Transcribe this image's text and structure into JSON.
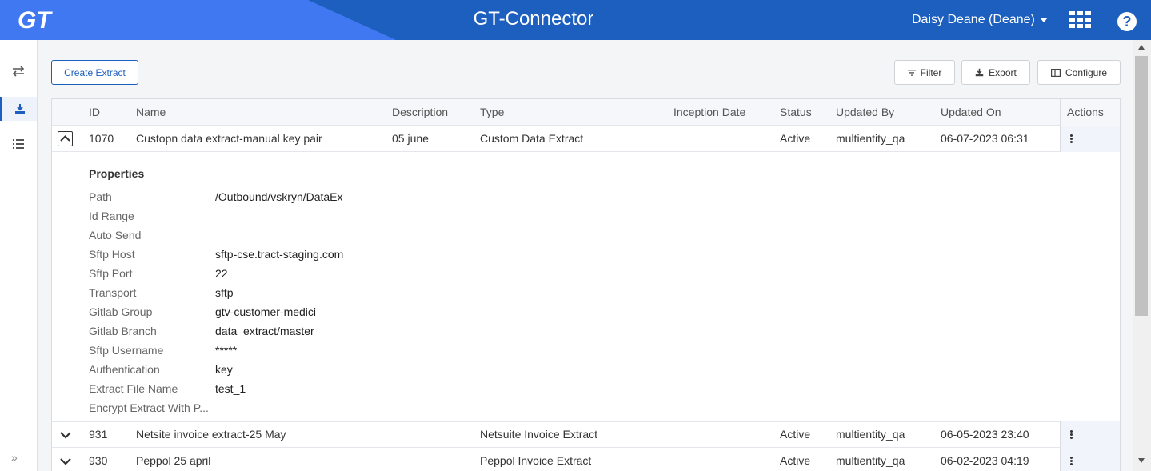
{
  "header": {
    "logo_text": "GT",
    "title": "GT-Connector",
    "user": "Daisy Deane (Deane)",
    "apps_icon": "grid-apps-icon",
    "help_icon": "help-icon",
    "help_label": "?"
  },
  "sidebar": {
    "items": [
      {
        "icon": "swap-arrows-icon"
      },
      {
        "icon": "download-icon",
        "active": true
      },
      {
        "icon": "list-icon"
      }
    ],
    "expand_label": "»"
  },
  "toolbar": {
    "create_label": "Create Extract",
    "filter_label": "Filter",
    "export_label": "Export",
    "configure_label": "Configure"
  },
  "table": {
    "columns": [
      "ID",
      "Name",
      "Description",
      "Type",
      "Inception Date",
      "Status",
      "Updated By",
      "Updated On",
      "Actions"
    ],
    "rows": [
      {
        "id": "1070",
        "name": "Custopn data extract-manual key pair",
        "description": "05 june",
        "type": "Custom Data Extract",
        "inception": "",
        "status": "Active",
        "updated_by": "multientity_qa",
        "updated_on": "06-07-2023 06:31",
        "expanded": true
      },
      {
        "id": "931",
        "name": "Netsite invoice extract-25 May",
        "description": "",
        "type": "Netsuite Invoice Extract",
        "inception": "",
        "status": "Active",
        "updated_by": "multientity_qa",
        "updated_on": "06-05-2023 23:40",
        "expanded": false
      },
      {
        "id": "930",
        "name": "Peppol 25 april",
        "description": "",
        "type": "Peppol Invoice Extract",
        "inception": "",
        "status": "Active",
        "updated_by": "multientity_qa",
        "updated_on": "06-02-2023 04:19",
        "expanded": false
      }
    ]
  },
  "properties": {
    "title": "Properties",
    "items": [
      {
        "key": "Path",
        "value": "/Outbound/vskryn/DataEx"
      },
      {
        "key": "Id Range",
        "value": ""
      },
      {
        "key": "Auto Send",
        "value": ""
      },
      {
        "key": "Sftp Host",
        "value": "sftp-cse.tract-staging.com"
      },
      {
        "key": "Sftp Port",
        "value": "22"
      },
      {
        "key": "Transport",
        "value": "sftp"
      },
      {
        "key": "Gitlab Group",
        "value": "gtv-customer-medici"
      },
      {
        "key": "Gitlab Branch",
        "value": "data_extract/master"
      },
      {
        "key": "Sftp Username",
        "value": "*****"
      },
      {
        "key": "Authentication",
        "value": "key"
      },
      {
        "key": "Extract File Name",
        "value": "test_1"
      },
      {
        "key": "Encrypt Extract With P...",
        "value": ""
      }
    ]
  },
  "colors": {
    "header": "#1d5fbf",
    "header_accent": "#4078f2",
    "primary": "#1d5fbf"
  }
}
